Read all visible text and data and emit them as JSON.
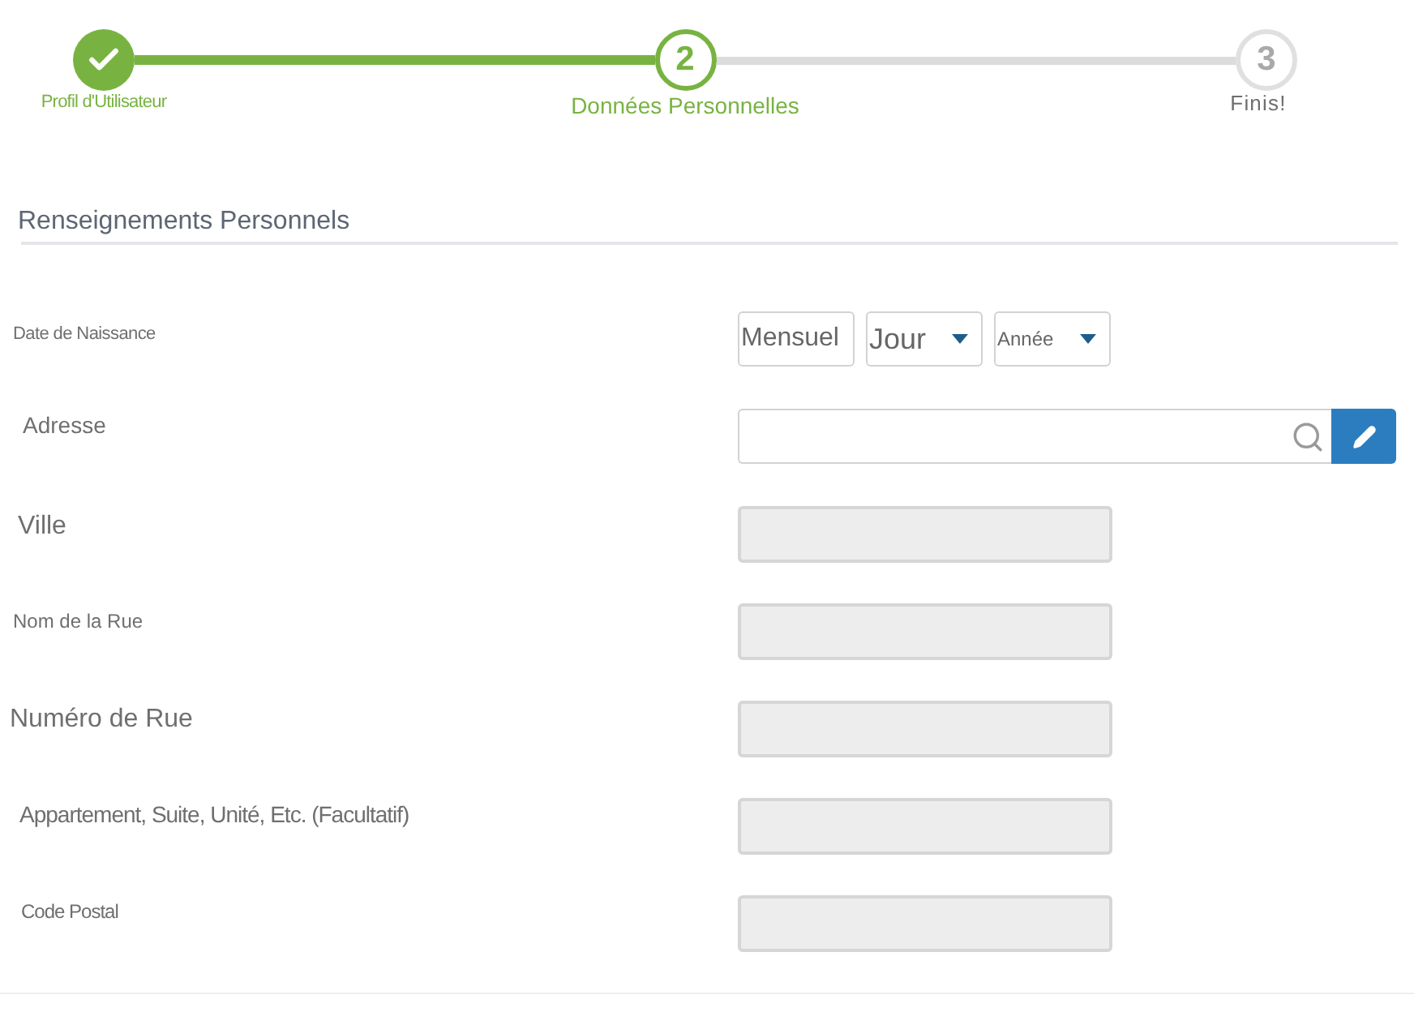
{
  "stepper": {
    "steps": [
      {
        "label": "Profil d'Utilisateur",
        "completed": true,
        "selected": false
      },
      {
        "number": "2",
        "label": "Données Personnelles",
        "completed": false,
        "selected": true
      },
      {
        "number": "3",
        "label": "Finis!",
        "completed": false,
        "selected": false
      }
    ]
  },
  "section": {
    "title": "Renseignements Personnels"
  },
  "fields": [
    {
      "kind": "date",
      "label": "Date de Naissance",
      "selects": [
        {
          "value": "Mensuel",
          "caret": false
        },
        {
          "value": "Jour",
          "caret": true
        },
        {
          "value": "Année",
          "caret": true
        }
      ]
    },
    {
      "kind": "search",
      "label": "Adresse"
    },
    {
      "kind": "text",
      "label": "Ville",
      "disabled": true
    },
    {
      "kind": "text",
      "label": "Nom de la Rue",
      "disabled": true
    },
    {
      "kind": "text",
      "label": "Numéro de Rue",
      "disabled": true
    },
    {
      "kind": "text",
      "label": "Appartement, Suite, Unité, Etc. (Facultatif)",
      "disabled": true
    },
    {
      "kind": "text",
      "label": "Code Postal",
      "disabled": true
    }
  ]
}
